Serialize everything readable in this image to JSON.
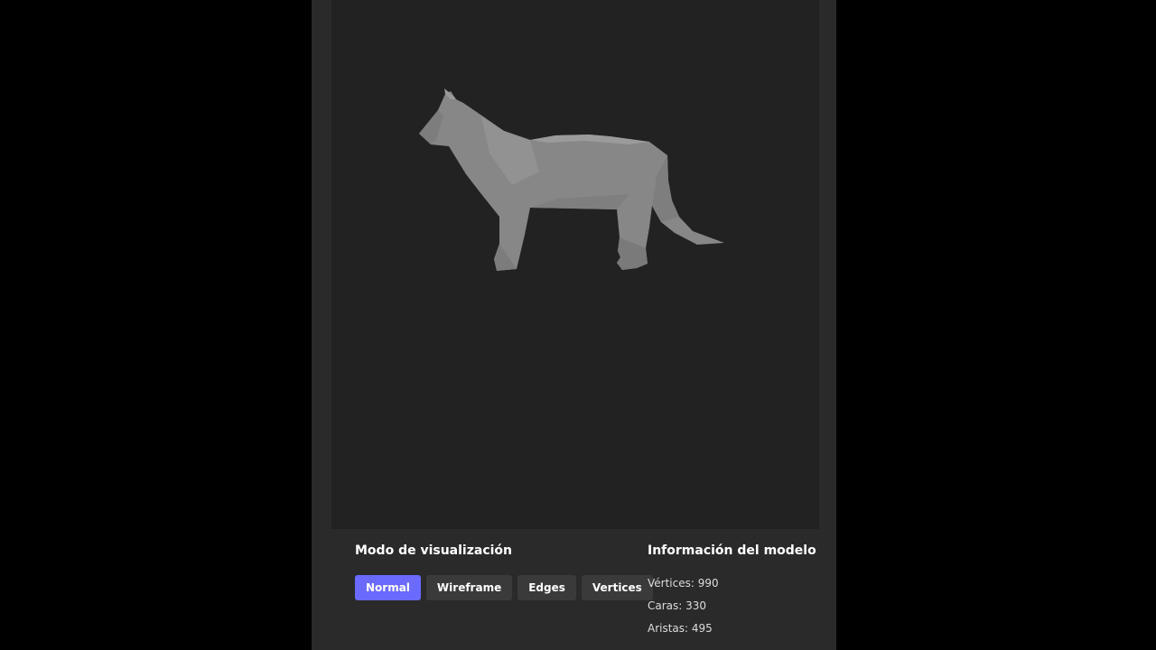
{
  "colors": {
    "page_bg": "#000000",
    "panel_bg": "#2a2a2a",
    "viewport_bg": "#222222",
    "model_fill": "#8a8a8a",
    "button_bg": "#3a3a3a",
    "button_active_bg": "#6a6aff"
  },
  "viewport": {
    "model_icon": "cat-model"
  },
  "display_mode": {
    "title": "Modo de visualización",
    "active": "Normal",
    "buttons": [
      {
        "label": "Normal"
      },
      {
        "label": "Wireframe"
      },
      {
        "label": "Edges"
      },
      {
        "label": "Vertices"
      }
    ]
  },
  "model_info": {
    "title": "Información del modelo",
    "lines": [
      "Vértices: 990",
      "Caras: 330",
      "Aristas: 495"
    ]
  }
}
